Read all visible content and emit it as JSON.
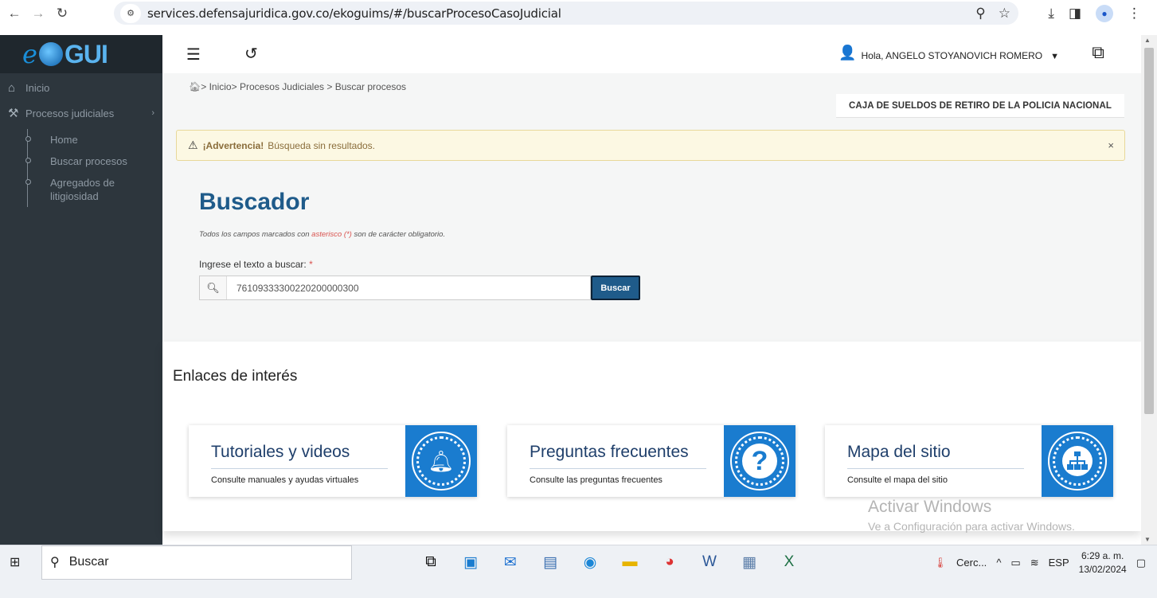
{
  "browser": {
    "url": "services.defensajuridica.gov.co/ekoguims/#/buscarProcesoCasoJudicial",
    "icons": [
      "back-icon",
      "forward-icon",
      "reload-icon",
      "site-settings-icon",
      "zoom-icon",
      "star-icon",
      "download-icon",
      "sidepanel-icon",
      "profile-icon",
      "menu-icon"
    ]
  },
  "sidebar": {
    "logo": {
      "prefix": "e",
      "suffix": "GUI"
    },
    "items": [
      {
        "label": "Inicio",
        "icon": "home-icon"
      },
      {
        "label": "Procesos judiciales",
        "icon": "gavel-icon"
      }
    ],
    "sub_items": [
      "Home",
      "Buscar procesos",
      "Agregados de litigiosidad"
    ]
  },
  "header": {
    "user_greeting": "Hola, ANGELO STOYANOVICH ROMERO"
  },
  "breadcrumb": {
    "inicio": "Inicio",
    "procesos": "Procesos Judiciales",
    "current": "Buscar procesos"
  },
  "entity": "CAJA DE SUELDOS DE RETIRO DE LA POLICIA NACIONAL",
  "alert": {
    "title": "¡Advertencia!",
    "message": "Búsqueda sin resultados.",
    "close": "×"
  },
  "search": {
    "title": "Buscador",
    "note_pre": "Todos los campos marcados con",
    "note_red": "asterisco (*)",
    "note_post": "son de carácter obligatorio.",
    "label": "Ingrese el texto a buscar:",
    "required_mark": "*",
    "value": "76109333300220200000300",
    "button": "Buscar"
  },
  "links": {
    "heading": "Enlaces de interés",
    "cards": [
      {
        "title": "Tutoriales y videos",
        "subtitle": "Consulte manuales y ayudas virtuales",
        "icon": "bell-icon"
      },
      {
        "title": "Preguntas frecuentes",
        "subtitle": "Consulte las preguntas frecuentes",
        "icon": "question-icon"
      },
      {
        "title": "Mapa del sitio",
        "subtitle": "Consulte el mapa del sitio",
        "icon": "sitemap-icon"
      }
    ]
  },
  "watermark": {
    "line1": "Activar Windows",
    "line2": "Ve a Configuración para activar Windows."
  },
  "taskbar": {
    "search_label": "Buscar",
    "weather": "Cerc...",
    "lang": "ESP",
    "time": "6:29 a. m.",
    "date": "13/02/2024"
  }
}
